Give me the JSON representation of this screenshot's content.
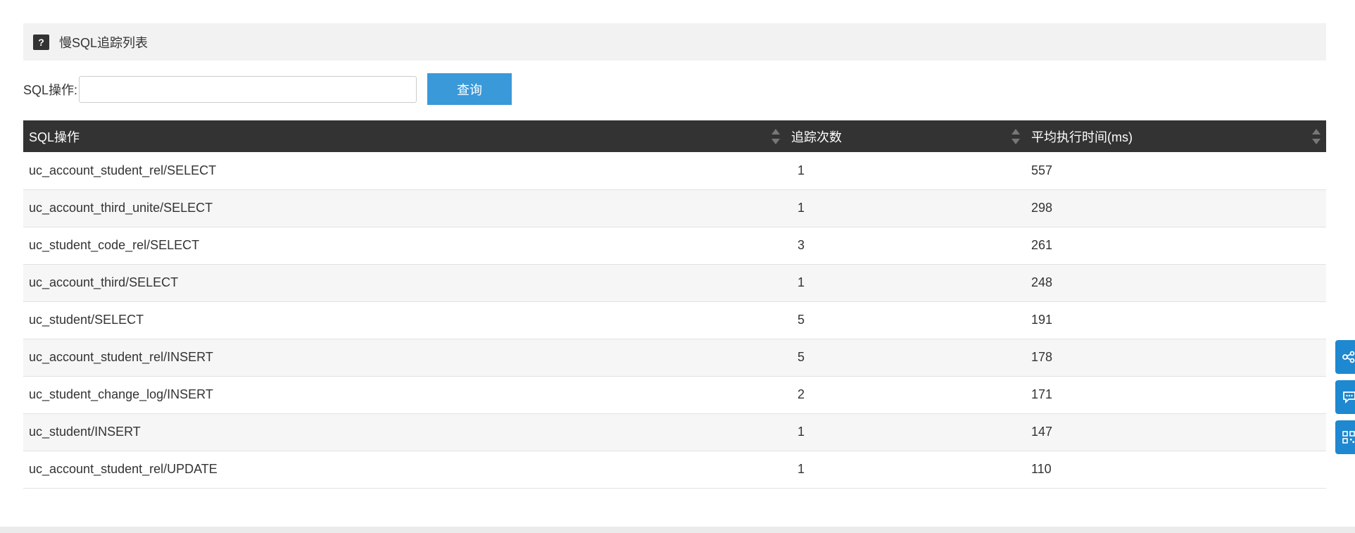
{
  "panel": {
    "title": "慢SQL追踪列表",
    "help_icon": "?"
  },
  "search": {
    "label": "SQL操作:",
    "value": "",
    "placeholder": "",
    "button_label": "查询"
  },
  "table": {
    "columns": [
      "SQL操作",
      "追踪次数",
      "平均执行时间(ms)"
    ],
    "rows": [
      [
        "uc_account_student_rel/SELECT",
        "1",
        "557"
      ],
      [
        "uc_account_third_unite/SELECT",
        "1",
        "298"
      ],
      [
        "uc_student_code_rel/SELECT",
        "3",
        "261"
      ],
      [
        "uc_account_third/SELECT",
        "1",
        "248"
      ],
      [
        "uc_student/SELECT",
        "5",
        "191"
      ],
      [
        "uc_account_student_rel/INSERT",
        "5",
        "178"
      ],
      [
        "uc_student_change_log/INSERT",
        "2",
        "171"
      ],
      [
        "uc_student/INSERT",
        "1",
        "147"
      ],
      [
        "uc_account_student_rel/UPDATE",
        "1",
        "110"
      ]
    ]
  },
  "side_buttons": [
    "share-icon",
    "chat-icon",
    "qrcode-icon"
  ],
  "colors": {
    "header_bg": "#333333",
    "button_bg": "#3a99d9",
    "side_button_bg": "#1e88d0"
  }
}
